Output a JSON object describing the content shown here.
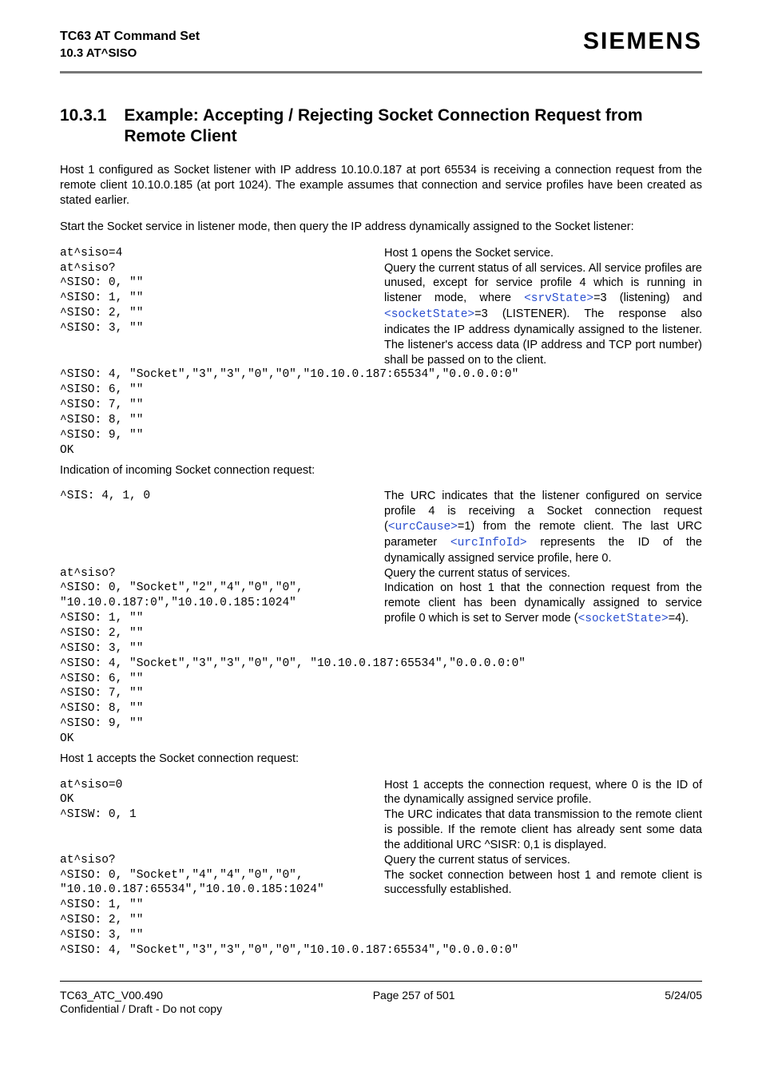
{
  "header": {
    "doc_title": "TC63 AT Command Set",
    "doc_subtitle": "10.3 AT^SISO",
    "brand": "SIEMENS"
  },
  "section": {
    "number": "10.3.1",
    "title": "Example: Accepting / Rejecting Socket Connection Request from Remote Client"
  },
  "intro1": "Host 1 configured as Socket listener with IP address 10.10.0.187 at port 65534 is receiving a connection request from the remote client 10.10.0.185 (at port 1024). The example assumes that connection and service profiles have been created as stated earlier.",
  "intro2": "Start the Socket service in listener mode, then query the IP address dynamically assigned to the Socket listener:",
  "block1": {
    "row1_code": "at^siso=4",
    "row1_desc": "Host 1 opens the Socket service.",
    "row2_code": "at^siso?\n^SISO: 0, \"\"\n^SISO: 1, \"\"\n^SISO: 2, \"\"\n^SISO: 3, \"\"",
    "row2_desc_a": "Query the current status of all services. All service profiles are unused, except for service profile 4 which is running in listener mode, where ",
    "row2_param1": "<srvState>",
    "row2_mid1": "=3 (listening) and ",
    "row2_param2": "<socketState>",
    "row2_desc_b": "=3 (LISTENER). The response also indicates the IP address dynamically assigned to the listener. The listener's access data (IP address and TCP port number) shall be passed on to the client.",
    "tail": "^SISO: 4, \"Socket\",\"3\",\"3\",\"0\",\"0\",\"10.10.0.187:65534\",\"0.0.0.0:0\"\n^SISO: 6, \"\"\n^SISO: 7, \"\"\n^SISO: 8, \"\"\n^SISO: 9, \"\"\nOK"
  },
  "label2": "Indication of incoming Socket connection request:",
  "block2": {
    "row1_code": "^SIS: 4, 1, 0",
    "row1_desc_a": "The URC indicates that the listener configured on service profile 4 is receiving a Socket connection request (",
    "row1_param1": "<urcCause>",
    "row1_mid1": "=1) from the remote client. The last URC parameter ",
    "row1_param2": "<urcInfoId>",
    "row1_desc_b": " represents the ID of the dynamically assigned service profile, here 0.",
    "row2_code": "at^siso?",
    "row2_desc": "Query the current status of services.",
    "row3_code": "^SISO: 0, \"Socket\",\"2\",\"4\",\"0\",\"0\",\n\"10.10.0.187:0\",\"10.10.0.185:1024\"\n^SISO: 1, \"\"\n^SISO: 2, \"\"\n^SISO: 3, \"\"",
    "row3_desc_a": "Indication on host 1 that the connection request from the remote client has been dynamically assigned to service profile 0 which is set to Server mode (",
    "row3_param1": "<socketState>",
    "row3_desc_b": "=4).",
    "tail": "^SISO: 4, \"Socket\",\"3\",\"3\",\"0\",\"0\", \"10.10.0.187:65534\",\"0.0.0.0:0\"\n^SISO: 6, \"\"\n^SISO: 7, \"\"\n^SISO: 8, \"\"\n^SISO: 9, \"\"\nOK"
  },
  "label3": "Host 1 accepts the Socket connection request:",
  "block3": {
    "row1_code": "at^siso=0\nOK",
    "row1_desc": "Host 1 accepts the connection request, where 0 is the ID of the dynamically assigned service profile.",
    "row2_code": "^SISW: 0, 1",
    "row2_desc": "The URC indicates that data transmission to the remote client is possible. If the remote client has already sent some data the additional URC ^SISR: 0,1 is displayed.",
    "row3_code": "at^siso?",
    "row3_desc": "Query the current status of services.",
    "row4_code": "^SISO: 0, \"Socket\",\"4\",\"4\",\"0\",\"0\",\n\"10.10.0.187:65534\",\"10.10.0.185:1024\"\n^SISO: 1, \"\"\n^SISO: 2, \"\"\n^SISO: 3, \"\"",
    "row4_desc": "The socket connection between host 1 and remote client is successfully established.",
    "tail": "^SISO: 4, \"Socket\",\"3\",\"3\",\"0\",\"0\",\"10.10.0.187:65534\",\"0.0.0.0:0\""
  },
  "footer": {
    "left": "TC63_ATC_V00.490",
    "center": "Page 257 of 501",
    "right": "5/24/05",
    "conf": "Confidential / Draft - Do not copy"
  }
}
